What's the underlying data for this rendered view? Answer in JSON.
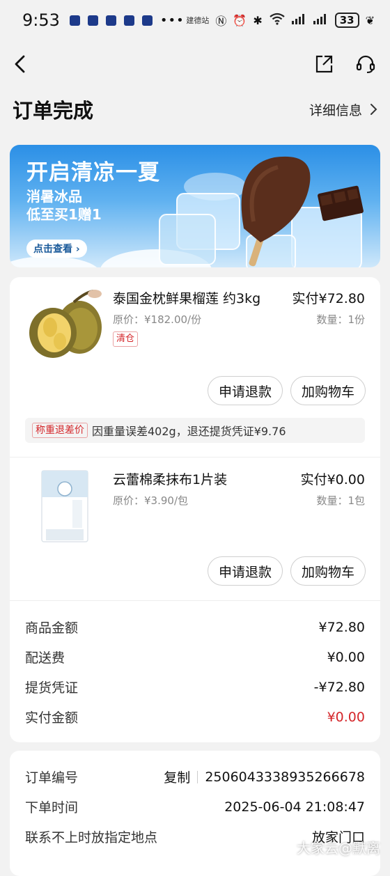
{
  "status_bar": {
    "time": "9:53",
    "dots": "•••",
    "station": "建德站",
    "battery": "33"
  },
  "page": {
    "title": "订单完成",
    "detail_link": "详细信息"
  },
  "banner": {
    "headline": "开启清凉一夏",
    "line1": "消暑冰品",
    "line2": "低至买1赠1",
    "cta": "点击查看"
  },
  "items": [
    {
      "name": "泰国金枕鲜果榴莲 约3kg",
      "paid": "实付¥72.80",
      "original": "原价：¥182.00/份",
      "quantity": "数量：1份",
      "tag": "清仓",
      "refund": "申请退款",
      "add_cart": "加购物车"
    },
    {
      "name": "云蕾棉柔抹布1片装",
      "paid": "实付¥0.00",
      "original": "原价：¥3.90/包",
      "quantity": "数量：1包",
      "refund": "申请退款",
      "add_cart": "加购物车"
    }
  ],
  "weight_notice": {
    "tag": "称重退差价",
    "text": "因重量误差402g，退还提货凭证¥9.76"
  },
  "summary": [
    {
      "label": "商品金额",
      "value": "¥72.80"
    },
    {
      "label": "配送费",
      "value": "¥0.00"
    },
    {
      "label": "提货凭证",
      "value": "-¥72.80"
    },
    {
      "label": "实付金额",
      "value": "¥0.00"
    }
  ],
  "order_info": {
    "number_label": "订单编号",
    "copy_label": "复制",
    "number": "2506043338935266678",
    "time_label": "下单时间",
    "time": "2025-06-04 21:08:47",
    "contact_label": "联系不上时放指定地点",
    "contact_value": "放家门口"
  },
  "watermark": "大家云@默离",
  "colors": {
    "accent_red": "#d4262a",
    "banner_blue": "#2b8fe6"
  }
}
